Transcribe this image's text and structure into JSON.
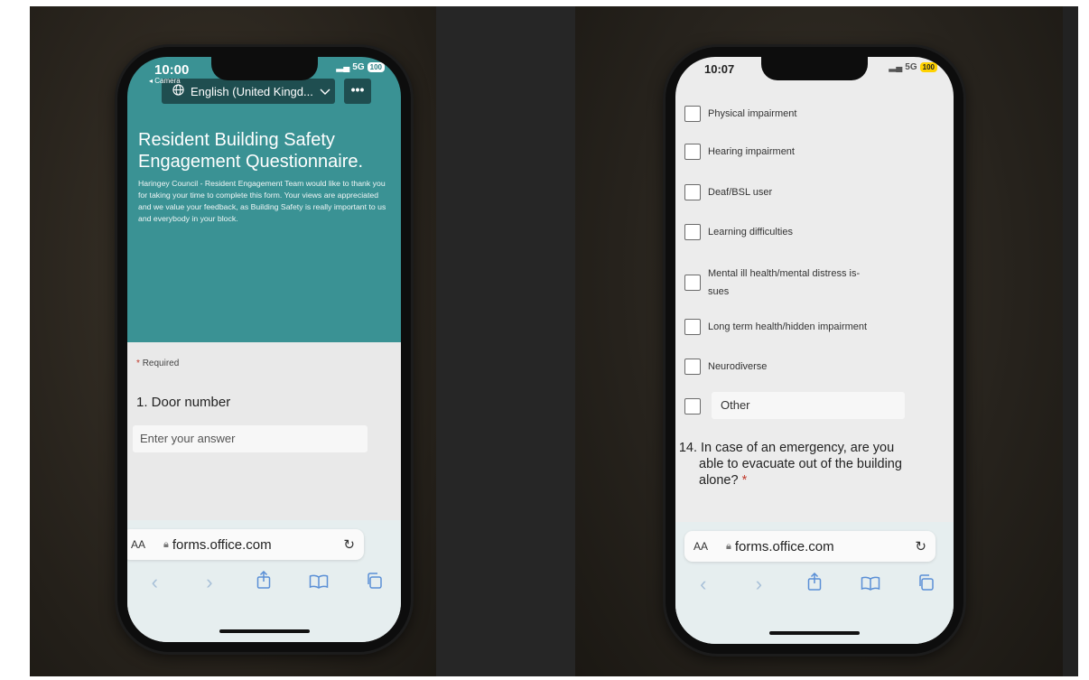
{
  "left_phone": {
    "status": {
      "time": "10:00",
      "back_app": "◂ Camera",
      "network": "5G",
      "battery": "100"
    },
    "language_selector": "English (United Kingd...",
    "more_label": "•••",
    "form": {
      "title": "Resident Building Safety Engagement Questionnaire.",
      "description": "Haringey Council - Resident Engagement Team would like to thank you for taking your time to complete this form. Your views are appreciated and we value your feedback, as Building Safety is really important to us and everybody in your block.",
      "required_mark": "*",
      "required_label": "Required",
      "question_1": "1. Door number",
      "answer_placeholder": "Enter your answer"
    },
    "browser": {
      "text_size": "AA",
      "url": "forms.office.com"
    }
  },
  "right_phone": {
    "status": {
      "time": "10:07",
      "network": "5G",
      "battery": "100"
    },
    "options": [
      "Physical impairment",
      "Hearing impairment",
      "Deaf/BSL user",
      "Learning difficulties",
      "Mental ill health/mental distress is-",
      "sues",
      "Long term health/hidden impairment",
      "Neurodiverse"
    ],
    "other_label": "Other",
    "question_14": {
      "number": "14.",
      "line1": "In case of an emergency, are you",
      "line2": "able to evacuate out of the building",
      "line3": "alone?",
      "required_mark": "*"
    },
    "browser": {
      "text_size": "AA",
      "url": "forms.office.com"
    }
  },
  "colors": {
    "form_header": "#3a9294",
    "accent_blue": "#5a8fd6",
    "required_red": "#c0392b"
  },
  "icons": [
    "globe-icon",
    "chevron-down-icon",
    "lock-icon",
    "reload-icon",
    "back-icon",
    "forward-icon",
    "share-icon",
    "bookmarks-icon",
    "tabs-icon"
  ]
}
